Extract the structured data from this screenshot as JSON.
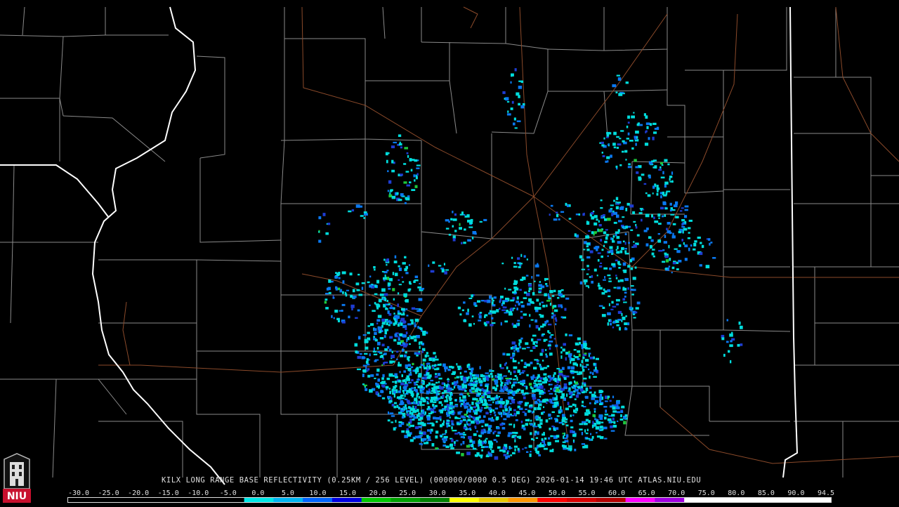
{
  "product": {
    "caption": "KILX LONG RANGE BASE REFLECTIVITY (0.25KM / 256 LEVEL) (000000/0000 0.5 DEG) 2026-01-14 19:46 UTC  ATLAS.NIU.EDU"
  },
  "scale": {
    "labels": [
      "-30.0",
      "-25.0",
      "-20.0",
      "-15.0",
      "-10.0",
      "-5.0",
      "0.0",
      "5.0",
      "10.0",
      "15.0",
      "20.0",
      "25.0",
      "30.0",
      "35.0",
      "40.0",
      "45.0",
      "50.0",
      "55.0",
      "60.0",
      "65.0",
      "70.0",
      "75.0",
      "80.0",
      "85.0",
      "90.0",
      "94.5"
    ],
    "colors": [
      "#000000",
      "#000000",
      "#000000",
      "#000000",
      "#000000",
      "#000000",
      "#00e6e6",
      "#00b4f0",
      "#0064ff",
      "#0000e0",
      "#00c800",
      "#00a000",
      "#008000",
      "#ffff00",
      "#e6c800",
      "#ff9600",
      "#ff0000",
      "#d70000",
      "#b40000",
      "#ff00ff",
      "#a000e0",
      "#ffffff",
      "#ffffff",
      "#ffffff",
      "#ffffff",
      "#ffffff"
    ]
  },
  "logo": {
    "text": "NIU",
    "color": "#c8102e"
  },
  "legend_colors": {
    "light_cyan": "#00dcdc",
    "medium_blue": "#0a78f0",
    "dark_blue": "#1e3cd2",
    "green": "#1ec83c",
    "county_lines": "#8a8a8a",
    "state_lines": "#ffffff",
    "roads": "#8b4a2a"
  }
}
